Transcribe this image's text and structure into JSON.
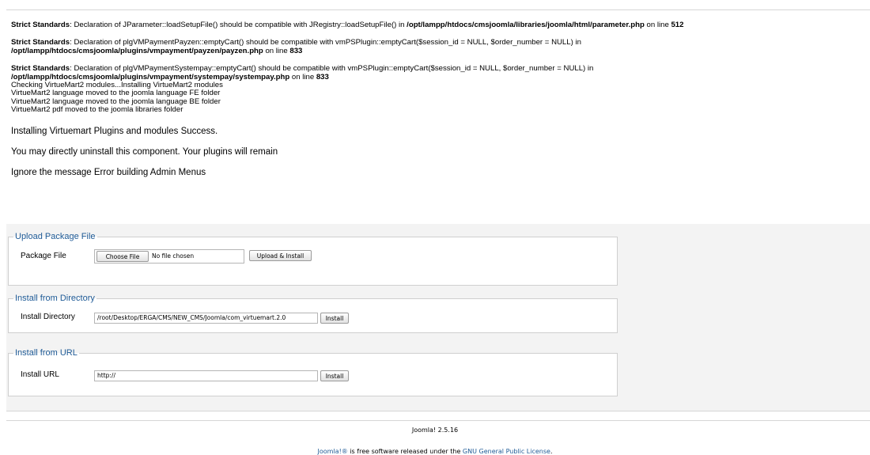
{
  "messages": {
    "warnings": [
      {
        "prefix": "Strict Standards",
        "text": ": Declaration of JParameter::loadSetupFile() should be compatible with JRegistry::loadSetupFile() in ",
        "path": "/opt/lampp/htdocs/cmsjoomla/libraries/joomla/html/parameter.php",
        "on_line": " on line ",
        "line_no": "512"
      },
      {
        "prefix": "Strict Standards",
        "text": ": Declaration of plgVMPaymentPayzen::emptyCart() should be compatible with vmPSPlugin::emptyCart($session_id = NULL, $order_number = NULL) in",
        "path": "/opt/lampp/htdocs/cmsjoomla/plugins/vmpayment/payzen/payzen.php",
        "on_line": " on line ",
        "line_no": "833"
      },
      {
        "prefix": "Strict Standards",
        "text": ": Declaration of plgVMPaymentSystempay::emptyCart() should be compatible with vmPSPlugin::emptyCart($session_id = NULL, $order_number = NULL) in",
        "path": "/opt/lampp/htdocs/cmsjoomla/plugins/vmpayment/systempay/systempay.php",
        "on_line": " on line ",
        "line_no": "833"
      }
    ],
    "status_lines": [
      "Checking VirtueMart2 modules...Installing VirtueMart2 modules",
      "VirtueMart2 language moved to the joomla language FE folder",
      "VirtueMart2 language moved to the joomla language BE folder",
      "VirtueMart2 pdf moved to the joomla libraries folder"
    ],
    "success": "Installing Virtuemart Plugins and modules Success.",
    "uninstall_note": "You may directly uninstall this component. Your plugins will remain",
    "ignore_note": "Ignore the message Error building Admin Menus"
  },
  "upload": {
    "legend": "Upload Package File",
    "label": "Package File",
    "choose_button": "Choose File",
    "file_status": "No file chosen",
    "submit": "Upload & Install"
  },
  "directory": {
    "legend": "Install from Directory",
    "label": "Install Directory",
    "value": "/root/Desktop/ERGA/CMS/NEW_CMS/Joomla/com_virtuemart.2.0",
    "submit": "Install"
  },
  "url": {
    "legend": "Install from URL",
    "label": "Install URL",
    "value": "http://",
    "submit": "Install"
  },
  "footer": {
    "version": "Joomla! 2.5.16",
    "license_link_1": "Joomla!®",
    "license_text": " is free software released under the ",
    "license_link_2": "GNU General Public License",
    "license_end": "."
  },
  "colors": {
    "legend": "#1e5a96",
    "link": "#1e5a96",
    "panel_bg": "#f3f3f3"
  }
}
